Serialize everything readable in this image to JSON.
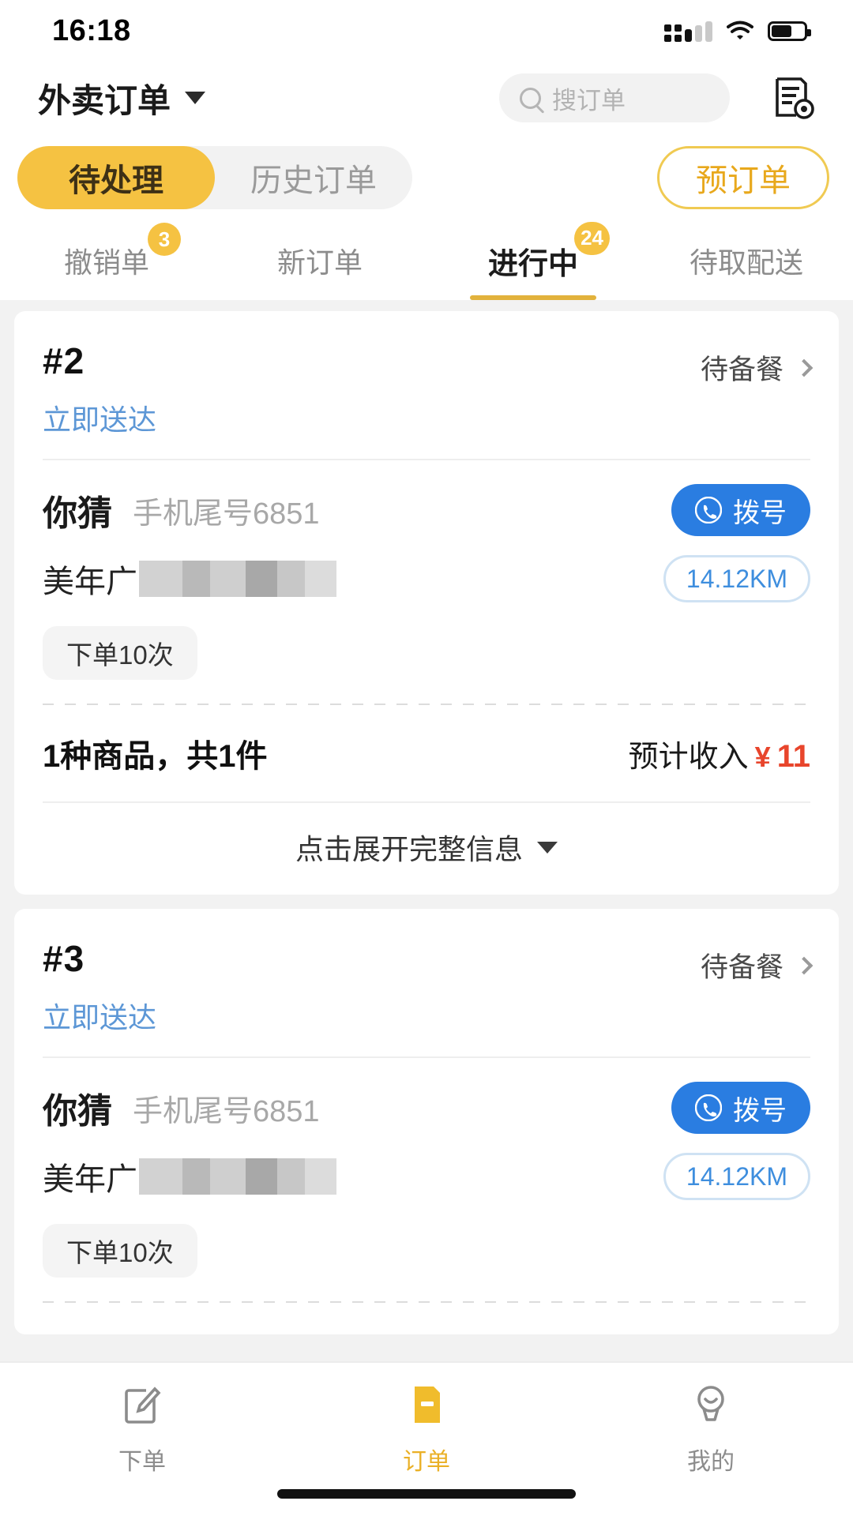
{
  "status_bar": {
    "time": "16:18",
    "signal_icon": "signal-dots-icon",
    "wifi_icon": "wifi-icon",
    "battery_icon": "battery-icon",
    "battery_level_pct": 62
  },
  "header": {
    "title": "外卖订单",
    "dropdown_icon": "chevron-down-icon",
    "search": {
      "placeholder": "搜订单",
      "value": "",
      "icon": "search-icon"
    },
    "settings_icon": "order-settings-icon"
  },
  "segment": {
    "items": [
      {
        "label": "待处理",
        "active": true
      },
      {
        "label": "历史订单",
        "active": false
      }
    ],
    "preorder_button": "预订单"
  },
  "sub_tabs": [
    {
      "label": "撤销单",
      "badge": "3",
      "active": false
    },
    {
      "label": "新订单",
      "badge": "",
      "active": false
    },
    {
      "label": "进行中",
      "badge": "24",
      "active": true
    },
    {
      "label": "待取配送",
      "badge": "",
      "active": false
    }
  ],
  "colors": {
    "accent_yellow": "#f5c242",
    "accent_yellow_dark": "#e8a81c",
    "link_blue": "#5d97d6",
    "call_blue": "#2a7de1",
    "price_red": "#e8452c",
    "muted_gray": "#8c8c8c"
  },
  "orders": [
    {
      "order_no": "#2",
      "status": "待备餐",
      "status_chevron": "chevron-right-icon",
      "delivery_type": "立即送达",
      "customer_name": "你猜",
      "customer_phone": "手机尾号6851",
      "call_label": "拨号",
      "call_icon": "phone-icon",
      "address": "美年广",
      "address_masked": true,
      "distance": "14.12KM",
      "order_count_tag": "下单10次",
      "item_summary": "1种商品，共1件",
      "income_label": "预计收入",
      "income_currency": "¥",
      "income_amount": "11",
      "expand_label": "点击展开完整信息",
      "expand_icon": "chevron-down-icon",
      "show_summary": true
    },
    {
      "order_no": "#3",
      "status": "待备餐",
      "status_chevron": "chevron-right-icon",
      "delivery_type": "立即送达",
      "customer_name": "你猜",
      "customer_phone": "手机尾号6851",
      "call_label": "拨号",
      "call_icon": "phone-icon",
      "address": "美年广",
      "address_masked": true,
      "distance": "14.12KM",
      "order_count_tag": "下单10次",
      "item_summary": "",
      "income_label": "",
      "income_currency": "",
      "income_amount": "",
      "expand_label": "",
      "expand_icon": "",
      "show_summary": false
    }
  ],
  "bottom_nav": [
    {
      "label": "下单",
      "icon": "compose-icon",
      "active": false
    },
    {
      "label": "订单",
      "icon": "order-doc-icon",
      "active": true
    },
    {
      "label": "我的",
      "icon": "profile-headset-icon",
      "active": false
    }
  ]
}
